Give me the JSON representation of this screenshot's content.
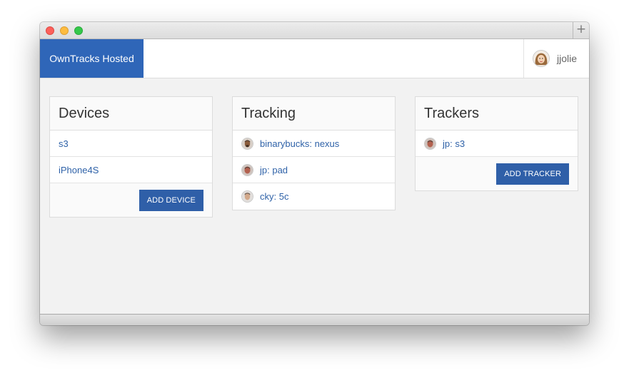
{
  "window": {
    "new_tab_symbol": "+"
  },
  "navbar": {
    "brand": "OwnTracks Hosted",
    "user": {
      "name": "jjolie",
      "avatar": "user-avatar"
    }
  },
  "devices": {
    "title": "Devices",
    "items": [
      {
        "label": "s3"
      },
      {
        "label": "iPhone4S"
      }
    ],
    "button": "ADD DEVICE"
  },
  "tracking": {
    "title": "Tracking",
    "items": [
      {
        "label": "binarybucks: nexus",
        "avatar": "user-avatar"
      },
      {
        "label": "jp: pad",
        "avatar": "user-avatar"
      },
      {
        "label": "cky: 5c",
        "avatar": "user-avatar"
      }
    ]
  },
  "trackers": {
    "title": "Trackers",
    "items": [
      {
        "label": "jp: s3",
        "avatar": "user-avatar"
      }
    ],
    "button": "ADD TRACKER"
  },
  "colors": {
    "brand": "#2f66b8",
    "link": "#2f62a8",
    "button": "#2f5fa8"
  }
}
